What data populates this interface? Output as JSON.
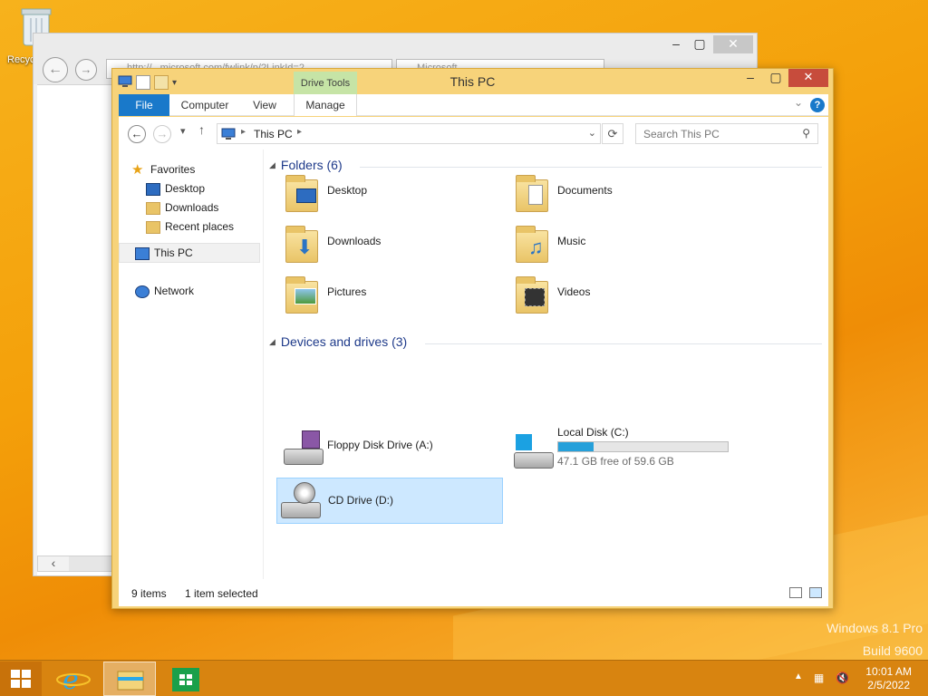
{
  "desktop": {
    "recycle_label": "Recyc",
    "watermark_line1": "Windows 8.1 Pro",
    "watermark_line2": "Build 9600"
  },
  "ie_window": {
    "address_text": "http://...microsoft.com/fwlink/p/?LinkId=2...",
    "tab_text": "Microsoft ..."
  },
  "explorer": {
    "title": "This PC",
    "context_tab": "Drive Tools",
    "ribbon_tabs": [
      "File",
      "Computer",
      "View",
      "Manage"
    ],
    "address": {
      "crumb": "This PC"
    },
    "search_placeholder": "Search This PC",
    "nav_pane": {
      "favorites": "Favorites",
      "desktop": "Desktop",
      "downloads": "Downloads",
      "recent": "Recent places",
      "this_pc": "This PC",
      "network": "Network"
    },
    "folders_header": "Folders (6)",
    "folders": [
      "Desktop",
      "Documents",
      "Downloads",
      "Music",
      "Pictures",
      "Videos"
    ],
    "devices_header": "Devices and drives (3)",
    "drives": {
      "floppy": "Floppy Disk Drive (A:)",
      "local_disk": "Local Disk (C:)",
      "local_disk_free": "47.1 GB free of 59.6 GB",
      "local_disk_used_fraction": 0.21,
      "cd": "CD Drive (D:)"
    },
    "status": {
      "items": "9 items",
      "selected": "1 item selected"
    }
  },
  "taskbar": {
    "time": "10:01 AM",
    "date": "2/5/2022"
  },
  "colors": {
    "accent": "#1979ca",
    "window_frame": "#f7d37a",
    "close_button": "#c74c3c",
    "selection": "#cde8ff",
    "progress": "#26a0da"
  }
}
